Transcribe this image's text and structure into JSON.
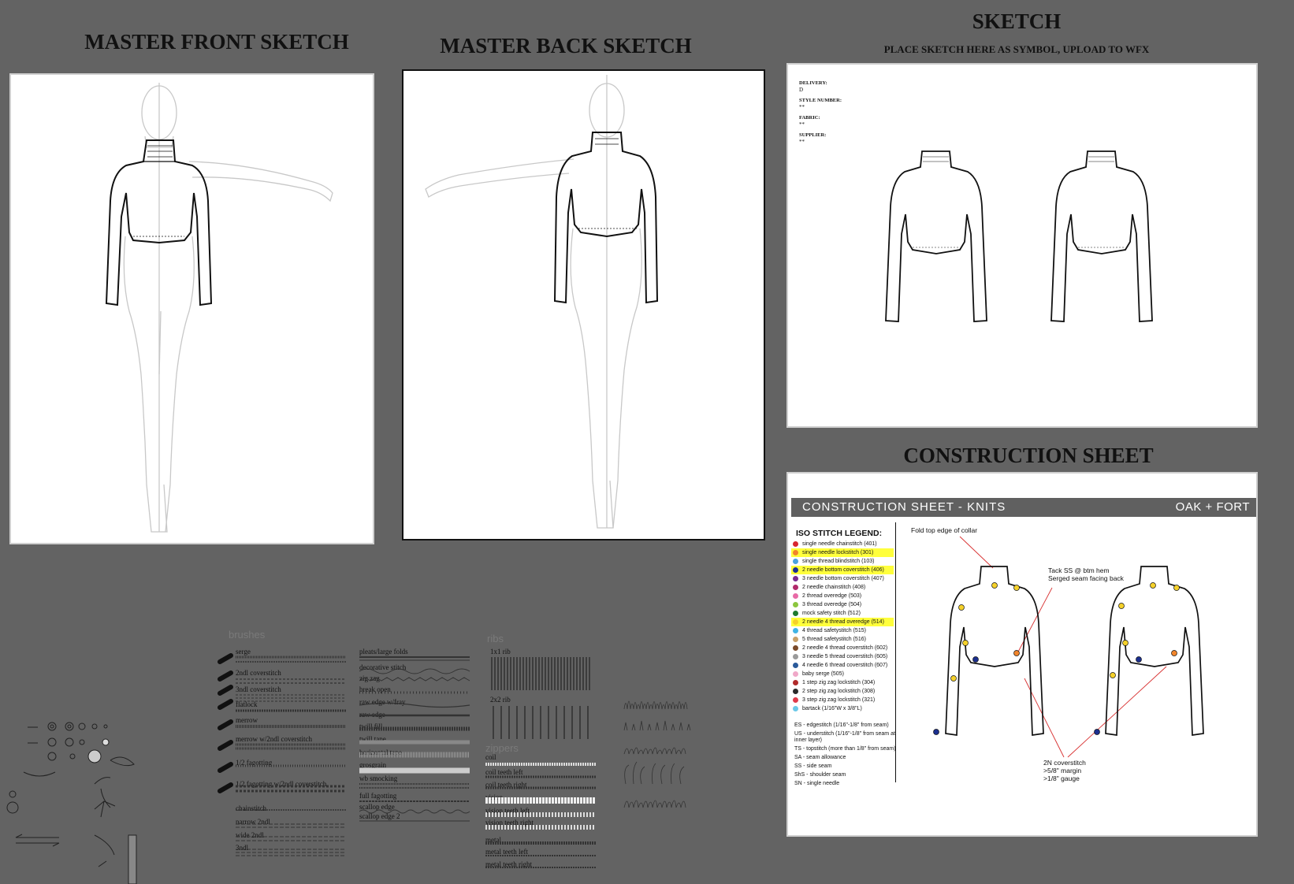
{
  "headings": {
    "front": "MASTER FRONT SKETCH",
    "back": "MASTER BACK SKETCH",
    "sketch": "SKETCH",
    "sketch_sub": "PLACE SKETCH HERE AS SYMBOL, UPLOAD TO WFX",
    "construction": "CONSTRUCTION SHEET"
  },
  "sketch_meta": [
    {
      "label": "DELIVERY:",
      "value": "D"
    },
    {
      "label": "STYLE NUMBER:",
      "value": "**"
    },
    {
      "label": "FABRIC:",
      "value": "**"
    },
    {
      "label": "SUPPLIER:",
      "value": "**"
    }
  ],
  "construction": {
    "bar_left": "CONSTRUCTION SHEET - KNITS",
    "bar_right": "OAK + FORT",
    "legend_title": "ISO STITCH LEGEND:",
    "legend": [
      {
        "num": "1",
        "label": "single needle chainstitch (401)",
        "color": "#d8262f",
        "highlight": false
      },
      {
        "num": "2",
        "label": "single needle lockstitch (301)",
        "color": "#f1852b",
        "highlight": true
      },
      {
        "num": "3",
        "label": "single thread blindstitch (103)",
        "color": "#4aa3df",
        "highlight": false
      },
      {
        "num": "4",
        "label": "2 needle bottom coverstitch (406)",
        "color": "#1b2f8f",
        "highlight": true
      },
      {
        "num": "5",
        "label": "3 needle bottom coverstitch (407)",
        "color": "#7b2a8f",
        "highlight": false
      },
      {
        "num": "6",
        "label": "2 needle chainstitch  (408)",
        "color": "#b12a6b",
        "highlight": false
      },
      {
        "num": "7",
        "label": "2 thread overedge (503)",
        "color": "#e86aa6",
        "highlight": false
      },
      {
        "num": "8",
        "label": "3 thread overedge (504)",
        "color": "#8cc63f",
        "highlight": false
      },
      {
        "num": "9",
        "label": "mock safety stitch (512)",
        "color": "#1f7a2e",
        "highlight": false
      },
      {
        "num": "10",
        "label": "2 needle 4 thread overedge (514)",
        "color": "#f5d12a",
        "highlight": true
      },
      {
        "num": "11",
        "label": "4 thread safetystitch (515)",
        "color": "#40b4e6",
        "highlight": false
      },
      {
        "num": "12",
        "label": "5 thread safetystitch (516)",
        "color": "#c8a06a",
        "highlight": false
      },
      {
        "num": "13",
        "label": "2 needle 4 thread coverstitch (602)",
        "color": "#7a4a2a",
        "highlight": false
      },
      {
        "num": "14",
        "label": "3 needle 5 thread coverstitch (605)",
        "color": "#9a9a9a",
        "highlight": false
      },
      {
        "num": "15",
        "label": "4 needle 6 thread coverstitch (607)",
        "color": "#2a5a9a",
        "highlight": false
      },
      {
        "num": "16",
        "label": "baby serge (505)",
        "color": "#f0a8c8",
        "highlight": false
      },
      {
        "num": "17",
        "label": "1 step zig zag lockstitch (304)",
        "color": "#b02a2a",
        "highlight": false
      },
      {
        "num": "18",
        "label": "2 step zig zag lockstitch (308)",
        "color": "#2a2a2a",
        "highlight": false
      },
      {
        "num": "19",
        "label": "3 step zig zag lockstitch (321)",
        "color": "#e03a4a",
        "highlight": false
      },
      {
        "num": "20",
        "label": "bartack (1/16\"W x 3/8\"L)",
        "color": "#6ac8e8",
        "highlight": false
      }
    ],
    "abbreviations": [
      "ES - edgestitch (1/16\"-1/8\" from seam)",
      "US - understitch (1/16\"-1/8\" from seam at inner layer)",
      "TS - topstitch (more than 1/8\" from seam)",
      "SA - seam allowance",
      "SS - side seam",
      "ShS - shoulder seam",
      "SN - single needle"
    ],
    "notes": {
      "collar": "Fold top edge of collar",
      "hem_1": "Tack SS @ btm hem",
      "hem_2": "Serged seam facing back",
      "cover_1": "2N coverstitch",
      "cover_2": ">5/8\" margin",
      "cover_3": ">1/8\" gauge"
    }
  },
  "library": {
    "brushes_title": "brushes",
    "brushes_col1": [
      "serge",
      "2ndl coverstitch",
      "3ndl coverstitch",
      "flatlock",
      "merrow",
      "merrow w/2ndl coverstitch",
      "1/2 fagotting",
      "1/2 fagotting w/2ndl coverstitch",
      "chainstitch",
      "narrow 2ndl",
      "wide 2ndl",
      "3ndl"
    ],
    "brushes_col2": [
      "pleats/large folds",
      "decorative stitch",
      "zig zag",
      "break open",
      "raw edge w/fray",
      "raw edge",
      "twill fill",
      "twill tape",
      "horizontal tape",
      "grosgrain",
      "wb smocking",
      "full fagotting",
      "scallop edge",
      "scallop edge 2"
    ],
    "ribs_title": "ribs",
    "ribs": [
      "1x1 rib",
      "2x2 rib"
    ],
    "zippers_title": "zippers",
    "zippers": [
      "coil",
      "coil teeth left",
      "coil teeth right",
      "vision",
      "vision teeth left",
      "vision teeth right",
      "metal",
      "metal teeth left",
      "metal  teeth right"
    ]
  }
}
